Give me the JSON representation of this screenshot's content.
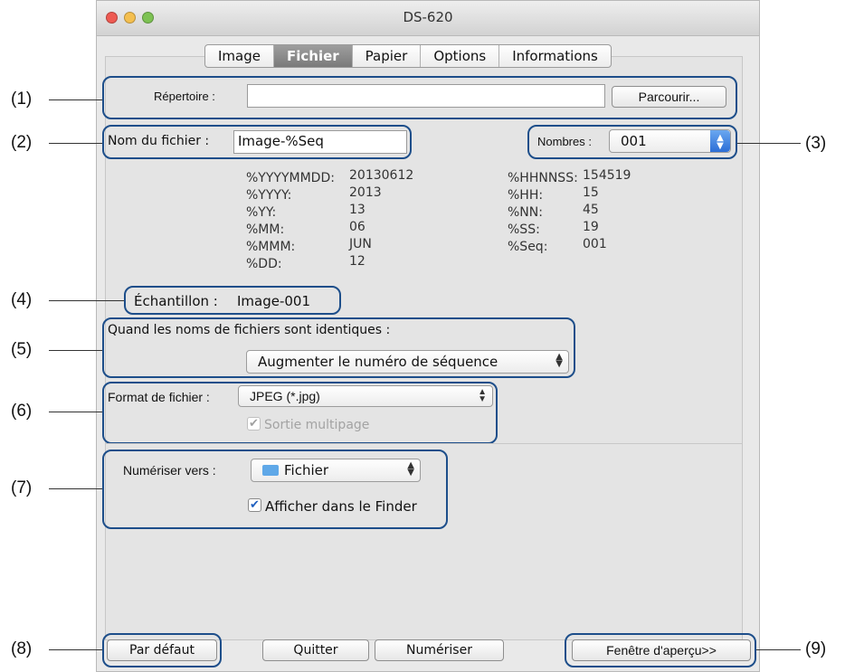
{
  "window": {
    "title": "DS-620"
  },
  "tabs": [
    {
      "label": "Image",
      "selected": false
    },
    {
      "label": "Fichier",
      "selected": true
    },
    {
      "label": "Papier",
      "selected": false
    },
    {
      "label": "Options",
      "selected": false
    },
    {
      "label": "Informations",
      "selected": false
    }
  ],
  "callouts": [
    "(1)",
    "(2)",
    "(3)",
    "(4)",
    "(5)",
    "(6)",
    "(7)",
    "(8)",
    "(9)"
  ],
  "directory": {
    "label": "Répertoire :",
    "value": "",
    "browse_label": "Parcourir..."
  },
  "filename": {
    "label": "Nom du fichier :",
    "value": "Image-%Seq"
  },
  "numbers": {
    "label": "Nombres :",
    "value": "001"
  },
  "tokens_left": [
    {
      "key": "%YYYYMMDD:",
      "value": "20130612"
    },
    {
      "key": "%YYYY:",
      "value": "2013"
    },
    {
      "key": "%YY:",
      "value": "13"
    },
    {
      "key": "%MM:",
      "value": "06"
    },
    {
      "key": "%MMM:",
      "value": "JUN"
    },
    {
      "key": "%DD:",
      "value": "12"
    }
  ],
  "tokens_right": [
    {
      "key": "%HHNNSS:",
      "value": "154519"
    },
    {
      "key": "%HH:",
      "value": "15"
    },
    {
      "key": "%NN:",
      "value": "45"
    },
    {
      "key": "%SS:",
      "value": "19"
    },
    {
      "key": "%Seq:",
      "value": "001"
    }
  ],
  "sample": {
    "label": "Échantillon :",
    "value": "Image-001"
  },
  "identical": {
    "label": "Quand les noms de fichiers sont identiques :",
    "value": "Augmenter le numéro de séquence"
  },
  "format": {
    "label": "Format de fichier :",
    "value": "JPEG (*.jpg)",
    "multipage_label": "Sortie multipage",
    "multipage_checked": true
  },
  "scan_to": {
    "label": "Numériser vers :",
    "value": "Fichier",
    "show_finder_label": "Afficher dans le Finder",
    "show_finder_checked": true
  },
  "buttons": {
    "default": "Par défaut",
    "quit": "Quitter",
    "scan": "Numériser",
    "preview": "Fenêtre d'aperçu>>"
  },
  "colors": {
    "annotation": "#1d4e8a",
    "close": "#ee5a52",
    "minimize": "#f4bf4f",
    "zoom": "#7dc253",
    "folder": "#5fa8e8"
  },
  "icons": {
    "folder": "folder-icon",
    "updown": "updown-arrows-icon",
    "check": "checkmark-icon"
  }
}
